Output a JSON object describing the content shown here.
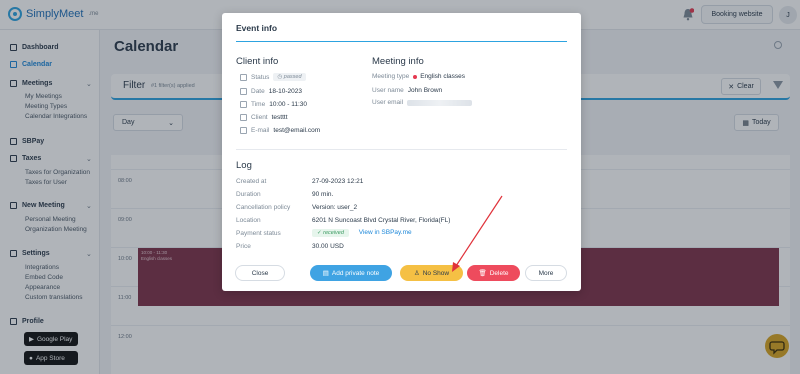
{
  "app": {
    "logo_text": "SimplyMeet",
    "logo_suffix": ".me",
    "booking_button": "Booking website",
    "avatar_initial": "J"
  },
  "sidebar": {
    "items": [
      {
        "label": "Dashboard"
      },
      {
        "label": "Calendar"
      },
      {
        "label": "Meetings"
      },
      {
        "label": "SBPay"
      },
      {
        "label": "Taxes"
      },
      {
        "label": "New Meeting"
      },
      {
        "label": "Settings"
      },
      {
        "label": "Profile"
      }
    ],
    "meetings_sub": [
      "My Meetings",
      "Meeting Types",
      "Calendar Integrations"
    ],
    "taxes_sub": [
      "Taxes for Organization",
      "Taxes for User"
    ],
    "new_meeting_sub": [
      "Personal Meeting",
      "Organization Meeting"
    ],
    "settings_sub": [
      "Integrations",
      "Embed Code",
      "Appearance",
      "Custom translations"
    ],
    "store_badges": [
      "Google Play",
      "App Store"
    ]
  },
  "main": {
    "title": "Calendar",
    "filter_label": "Filter",
    "filter_count": "#1 filter(s) applied",
    "clear_label": "Clear",
    "view_select": "Day",
    "today_label": "Today",
    "times": [
      "08:00",
      "09:00",
      "10:00",
      "11:00",
      "12:00"
    ],
    "event_block": {
      "time": "10:00 - 11:30",
      "title": "English classes",
      "color": "#7e3249"
    }
  },
  "modal": {
    "title": "Event info",
    "client_info": {
      "heading": "Client info",
      "status_key": "Status",
      "status_val": "passed",
      "date_key": "Date",
      "date_val": "18-10-2023",
      "time_key": "Time",
      "time_val": "10:00 - 11:30",
      "client_key": "Client",
      "client_val": "testttt",
      "email_key": "E-mail",
      "email_val": "test@email.com"
    },
    "meeting_info": {
      "heading": "Meeting info",
      "type_key": "Meeting type",
      "type_val": "English classes",
      "user_name_key": "User name",
      "user_name_val": "John Brown",
      "user_email_key": "User email"
    },
    "log": {
      "heading": "Log",
      "rows": [
        {
          "key": "Created at",
          "val": "27-09-2023 12:21"
        },
        {
          "key": "Duration",
          "val": "90 min."
        },
        {
          "key": "Cancellation policy",
          "val": "Version: user_2"
        },
        {
          "key": "Location",
          "val": "6201 N Suncoast Blvd Crystal River, Florida(FL)"
        },
        {
          "key": "Payment status",
          "val": "received"
        },
        {
          "key": "Price",
          "val": "30.00 USD"
        }
      ],
      "sbpay_link": "View in SBPay.me"
    },
    "buttons": {
      "close": "Close",
      "add_note": "Add private note",
      "no_show": "No Show",
      "delete": "Delete",
      "more": "More"
    }
  },
  "colors": {
    "accent": "#2da3e0",
    "no_show": "#f5c044",
    "delete": "#ee4b5d",
    "note": "#3fa3e3",
    "annotation_arrow": "#e0323a"
  }
}
